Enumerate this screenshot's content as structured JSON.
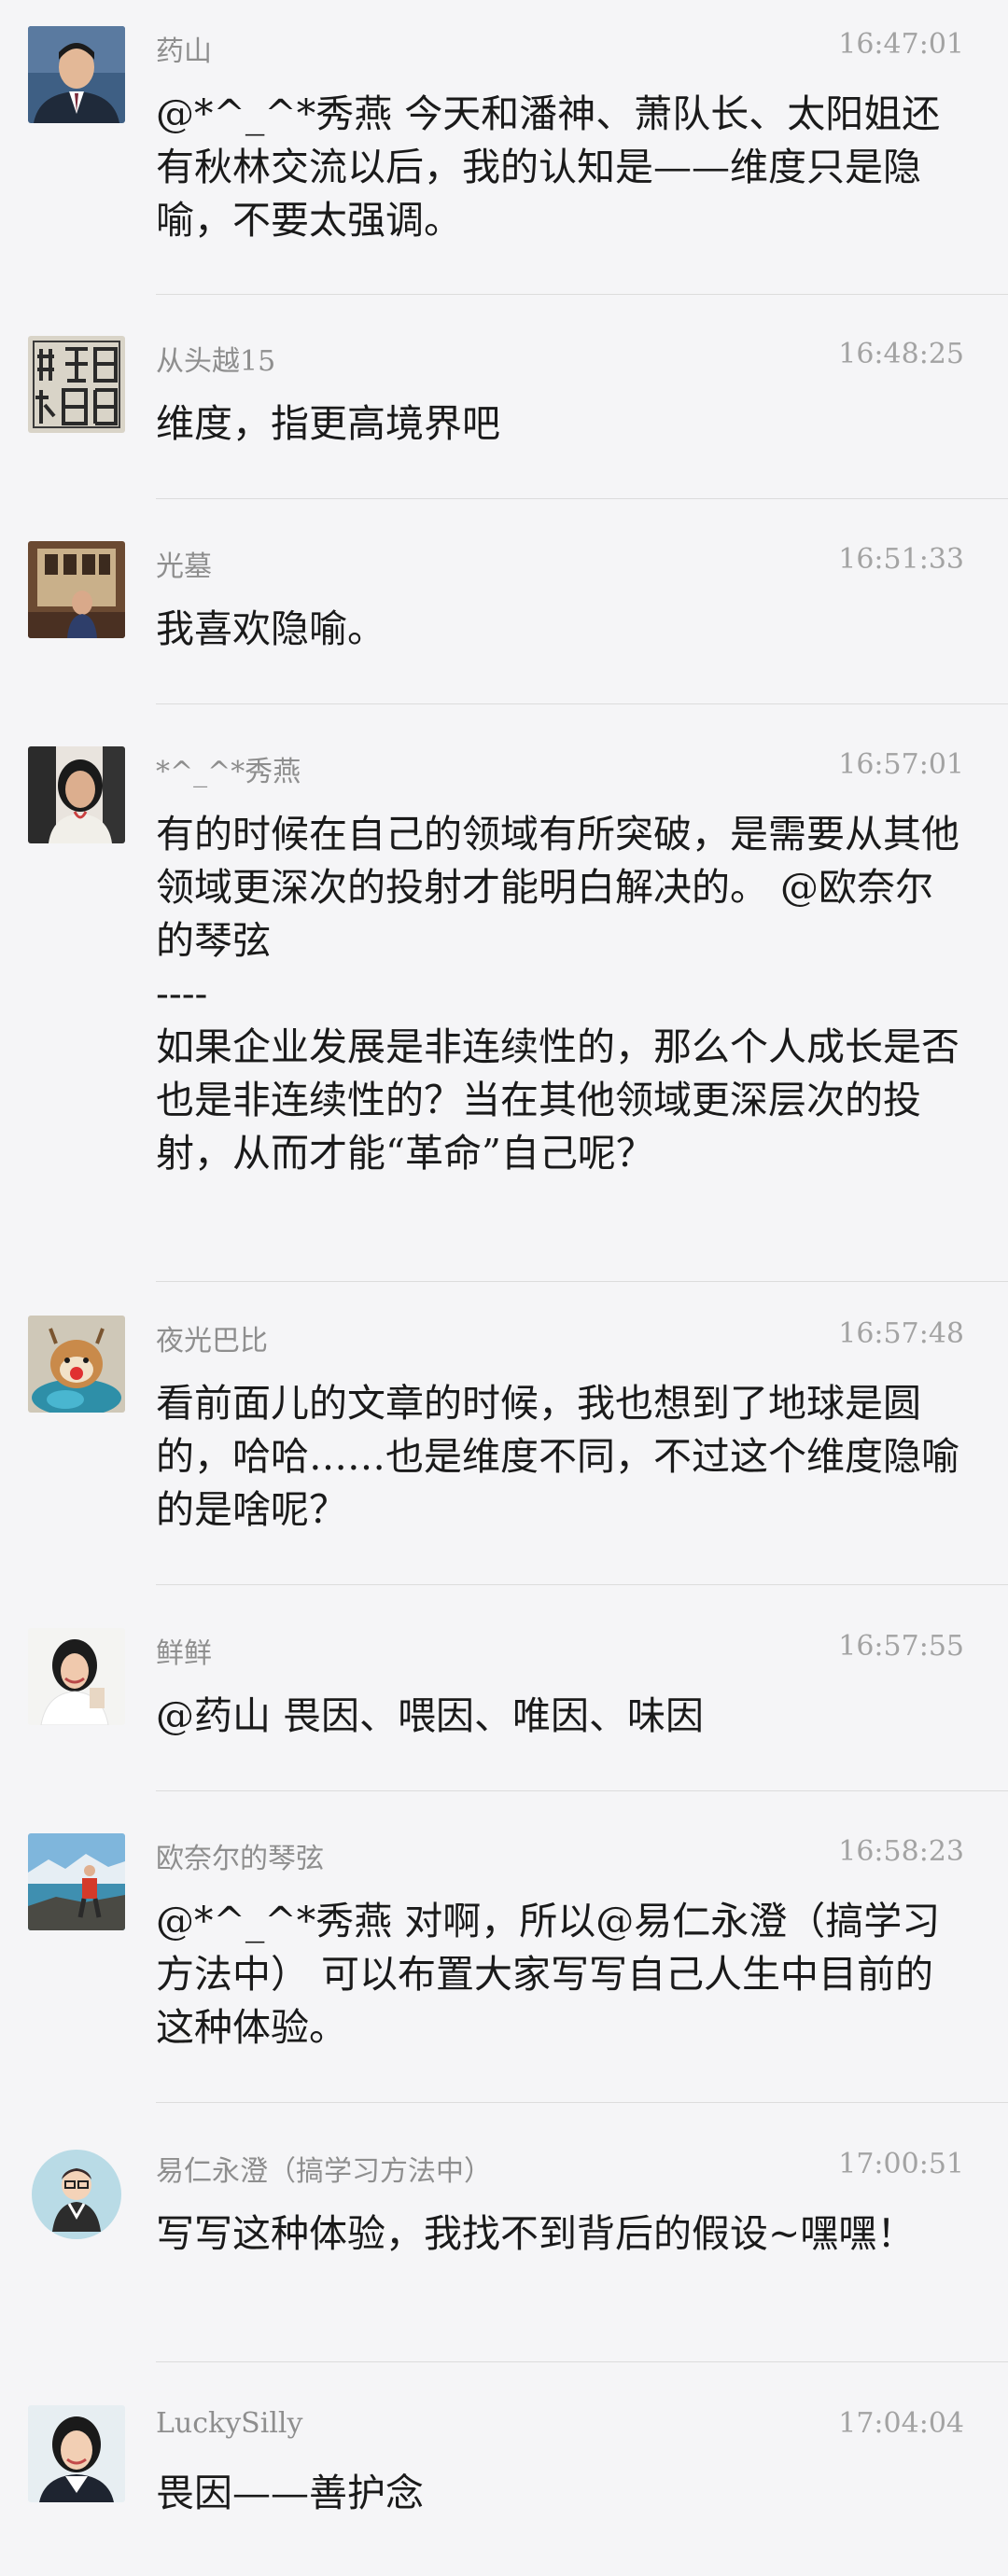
{
  "messages": [
    {
      "name": "药山",
      "time": "16:47:01",
      "text": "@*^_^*秀燕 今天和潘神、萧队长、太阳姐还有秋林交流以后，我的认知是——维度只是隐喻，不要太强调。"
    },
    {
      "name": "从头越15",
      "time": "16:48:25",
      "text": "维度，指更高境界吧"
    },
    {
      "name": "光墓",
      "time": "16:51:33",
      "text": "我喜欢隐喻。"
    },
    {
      "name": "*^_^*秀燕",
      "time": "16:57:01",
      "text": "有的时候在自己的领域有所突破，是需要从其他领域更深次的投射才能明白解决的。 @欧奈尔的琴弦\n----\n如果企业发展是非连续性的，那么个人成长是否也是非连续性的？当在其他领域更深层次的投射，从而才能“革命”自己呢？"
    },
    {
      "name": "夜光巴比",
      "time": "16:57:48",
      "text": "看前面儿的文章的时候，我也想到了地球是圆的，哈哈……也是维度不同，不过这个维度隐喻的是啥呢？"
    },
    {
      "name": "鲜鲜",
      "time": "16:57:55",
      "text": "@药山 畏因、喂因、唯因、味因"
    },
    {
      "name": "欧奈尔的琴弦",
      "time": "16:58:23",
      "text": "@*^_^*秀燕 对啊，所以@易仁永澄（搞学习方法中） 可以布置大家写写自己人生中目前的这种体验。"
    },
    {
      "name": "易仁永澄（搞学习方法中）",
      "time": "17:00:51",
      "text": "写写这种体验，我找不到背后的假设~嘿嘿！"
    },
    {
      "name": "LuckySilly",
      "time": "17:04:04",
      "text": "畏因——善护念"
    }
  ]
}
